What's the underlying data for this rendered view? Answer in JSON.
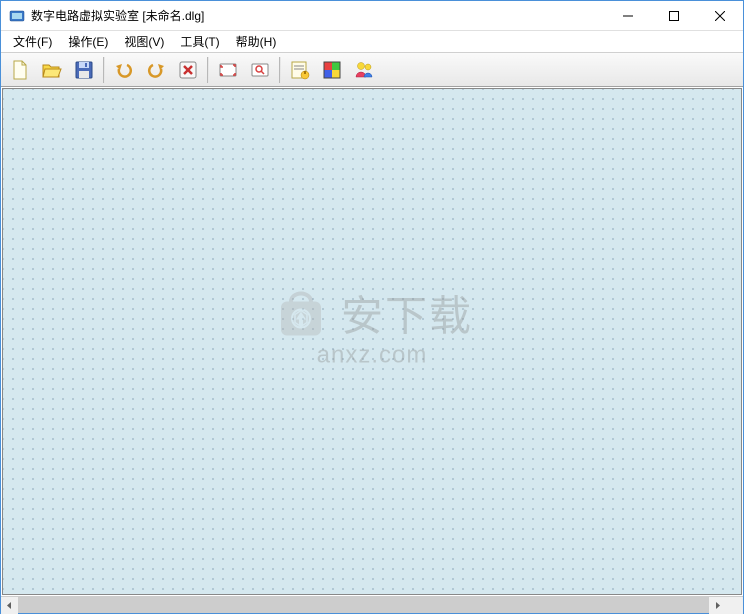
{
  "window": {
    "title": "数字电路虚拟实验室 [未命名.dlg]"
  },
  "menubar": {
    "items": [
      {
        "label": "文件(F)"
      },
      {
        "label": "操作(E)"
      },
      {
        "label": "视图(V)"
      },
      {
        "label": "工具(T)"
      },
      {
        "label": "帮助(H)"
      }
    ]
  },
  "toolbar": {
    "groups": [
      [
        {
          "name": "new-document",
          "kind": "new"
        },
        {
          "name": "open-file",
          "kind": "open"
        },
        {
          "name": "save-file",
          "kind": "save"
        }
      ],
      [
        {
          "name": "undo",
          "kind": "undo"
        },
        {
          "name": "redo",
          "kind": "redo"
        },
        {
          "name": "delete",
          "kind": "delete"
        }
      ],
      [
        {
          "name": "zoom-fit",
          "kind": "zoom-fit"
        },
        {
          "name": "zoom-region",
          "kind": "zoom-region"
        }
      ],
      [
        {
          "name": "properties",
          "kind": "properties"
        },
        {
          "name": "palette",
          "kind": "palette"
        },
        {
          "name": "users",
          "kind": "users"
        }
      ]
    ]
  },
  "watermark": {
    "text": "安下载",
    "url": "anxz.com"
  },
  "icons": {
    "new": "new",
    "open": "open",
    "save": "save",
    "undo": "undo",
    "redo": "redo",
    "delete": "delete",
    "zoom-fit": "zoom-fit",
    "zoom-region": "zoom-region",
    "properties": "properties",
    "palette": "palette",
    "users": "users"
  }
}
